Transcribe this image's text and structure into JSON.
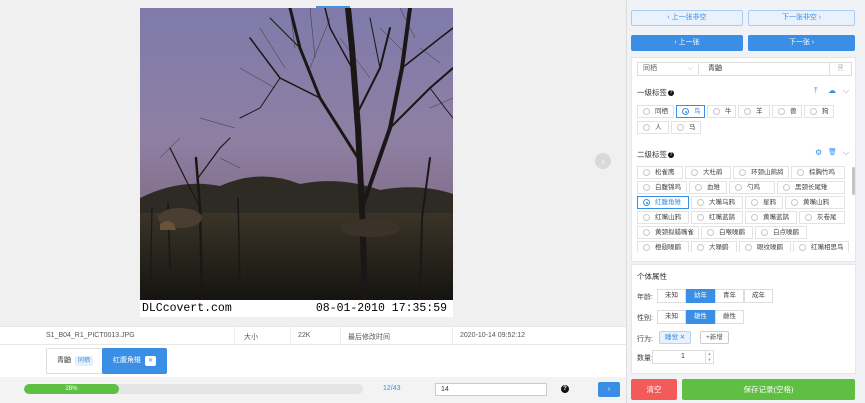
{
  "photo": {
    "watermark": "DLCcovert.com",
    "datetime": "08-01-2010  17:35:59"
  },
  "file_info": {
    "filename": "S1_B04_R1_PICT0013.JPG",
    "size_label": "大小",
    "size_value": "22K",
    "modified_label": "最后修改时间",
    "modified_value": "2020-10-14 09:52:12"
  },
  "tags": [
    {
      "label": "青鼬",
      "chip": "同栖",
      "active": false
    },
    {
      "label": "红腹角雉",
      "chip": "✕",
      "active": true
    }
  ],
  "bottom_bar": {
    "progress_percent": 28,
    "progress_label": "28%",
    "counter": "12/43",
    "jump_value": "14",
    "help": "?",
    "go": "›"
  },
  "nav": {
    "prev_empty": "‹  上一张非空",
    "next_empty": "下一张非空  ›",
    "prev": "‹  上一张",
    "next": "下一张  ›"
  },
  "species_row": {
    "select_value": "同栖",
    "caret": "⌵",
    "input_value": "青鼬",
    "doc_icon": "🗎"
  },
  "level1": {
    "title": "一级标签",
    "help": "?",
    "icons": {
      "upload": "⤒",
      "cloud": "☁",
      "collapse": "⌵"
    },
    "options": [
      {
        "label": "同栖",
        "selected": false
      },
      {
        "label": "鸟",
        "selected": true
      },
      {
        "label": "牛",
        "selected": false
      },
      {
        "label": "羊",
        "selected": false
      },
      {
        "label": "兽",
        "selected": false
      },
      {
        "label": "狗",
        "selected": false
      },
      {
        "label": "人",
        "selected": false
      },
      {
        "label": "马",
        "selected": false
      }
    ]
  },
  "level2": {
    "title": "二级标签",
    "help": "?",
    "icons": {
      "settings": "⚙",
      "delete": "🗑",
      "collapse": "⌵"
    },
    "options": [
      {
        "label": "松雀鹰",
        "selected": false
      },
      {
        "label": "大杜鹃",
        "selected": false
      },
      {
        "label": "环颈山鹧鸪",
        "selected": false
      },
      {
        "label": "棕胸竹鸡",
        "selected": false
      },
      {
        "label": "白腹锦鸡",
        "selected": false
      },
      {
        "label": "血雉",
        "selected": false
      },
      {
        "label": "勺鸡",
        "selected": false
      },
      {
        "label": "黑颈长尾雉",
        "selected": false
      },
      {
        "label": "红腹角雉",
        "selected": true
      },
      {
        "label": "大嘴乌鸦",
        "selected": false
      },
      {
        "label": "星鸦",
        "selected": false
      },
      {
        "label": "黄嘴山鸦",
        "selected": false
      },
      {
        "label": "红嘴山鸦",
        "selected": false
      },
      {
        "label": "红嘴蓝鹊",
        "selected": false
      },
      {
        "label": "黄嘴蓝鹊",
        "selected": false
      },
      {
        "label": "灰卷尾",
        "selected": false
      },
      {
        "label": "黄颈拟蜡嘴雀",
        "selected": false
      },
      {
        "label": "白喉噪鹛",
        "selected": false
      },
      {
        "label": "白点噪鹛",
        "selected": false
      },
      {
        "label": "橙翅噪鹛",
        "selected": false
      },
      {
        "label": "大噪鹛",
        "selected": false
      },
      {
        "label": "眼纹噪鹛",
        "selected": false
      },
      {
        "label": "红嘴相思鸟",
        "selected": false
      }
    ]
  },
  "individual": {
    "title": "个体属性",
    "age_label": "年龄:",
    "age_options": [
      {
        "label": "未知",
        "selected": false
      },
      {
        "label": "幼年",
        "selected": true
      },
      {
        "label": "青年",
        "selected": false
      },
      {
        "label": "成年",
        "selected": false
      }
    ],
    "sex_label": "性别:",
    "sex_options": [
      {
        "label": "未知",
        "selected": false
      },
      {
        "label": "雄性",
        "selected": true
      },
      {
        "label": "雌性",
        "selected": false
      }
    ],
    "behavior_label": "行为:",
    "behavior_tag": "睡觉  ✕",
    "behavior_add": "+新增",
    "count_label": "数量:",
    "count_value": "1",
    "count_up": "▲",
    "count_down": "▼"
  },
  "actions": {
    "clear": "清空",
    "save": "保存记录(空格)"
  }
}
